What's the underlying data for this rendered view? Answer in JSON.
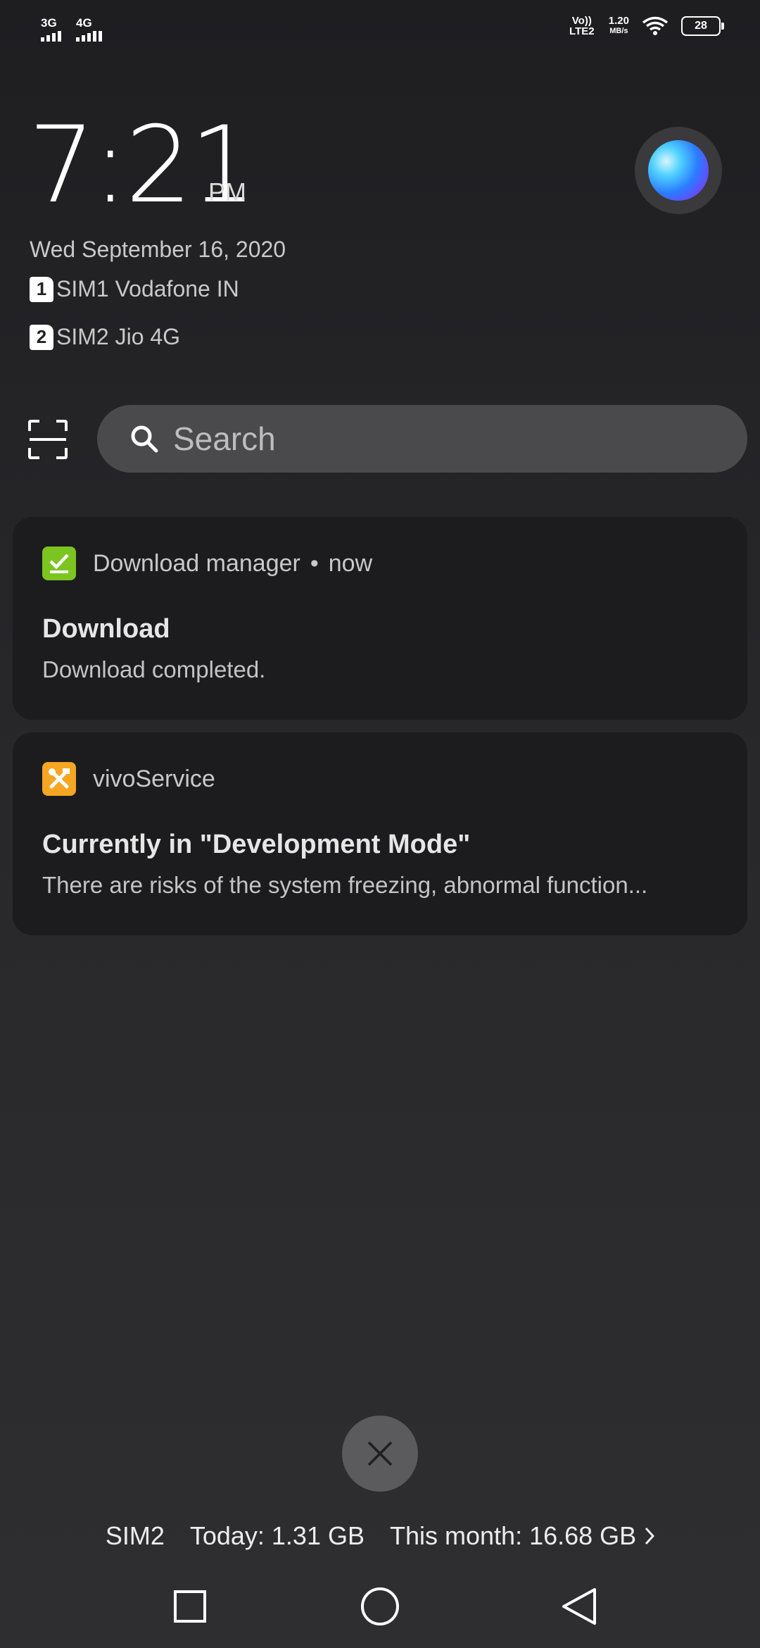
{
  "status_bar": {
    "sim1_network": "3G",
    "sim2_network": "4G",
    "volte": "Vo)) LTE2",
    "speed_value": "1.20",
    "speed_unit": "MB/s",
    "battery": "28"
  },
  "clock": {
    "time": "7:21",
    "ampm": "PM",
    "date": "Wed September 16, 2020",
    "sim1_number": "1",
    "sim1_label": "SIM1 Vodafone IN",
    "sim2_number": "2",
    "sim2_label": "SIM2 Jio 4G"
  },
  "search": {
    "placeholder": "Search"
  },
  "notifications": [
    {
      "app": "Download manager",
      "time": "now",
      "title": "Download",
      "body": "Download completed.",
      "icon": "download-check-icon",
      "icon_color": "#7cc520"
    },
    {
      "app": "vivoService",
      "title": "Currently in \"Development Mode\"",
      "body": "There are risks of the system freezing, abnormal function...",
      "icon": "tools-icon",
      "icon_color": "#f5a623"
    }
  ],
  "data_usage": {
    "sim": "SIM2",
    "today": "Today: 1.31 GB",
    "month": "This month: 16.68 GB"
  },
  "colors": {
    "background": "#262629",
    "card": "#1c1c1e",
    "search_bar": "#4a4a4c"
  }
}
